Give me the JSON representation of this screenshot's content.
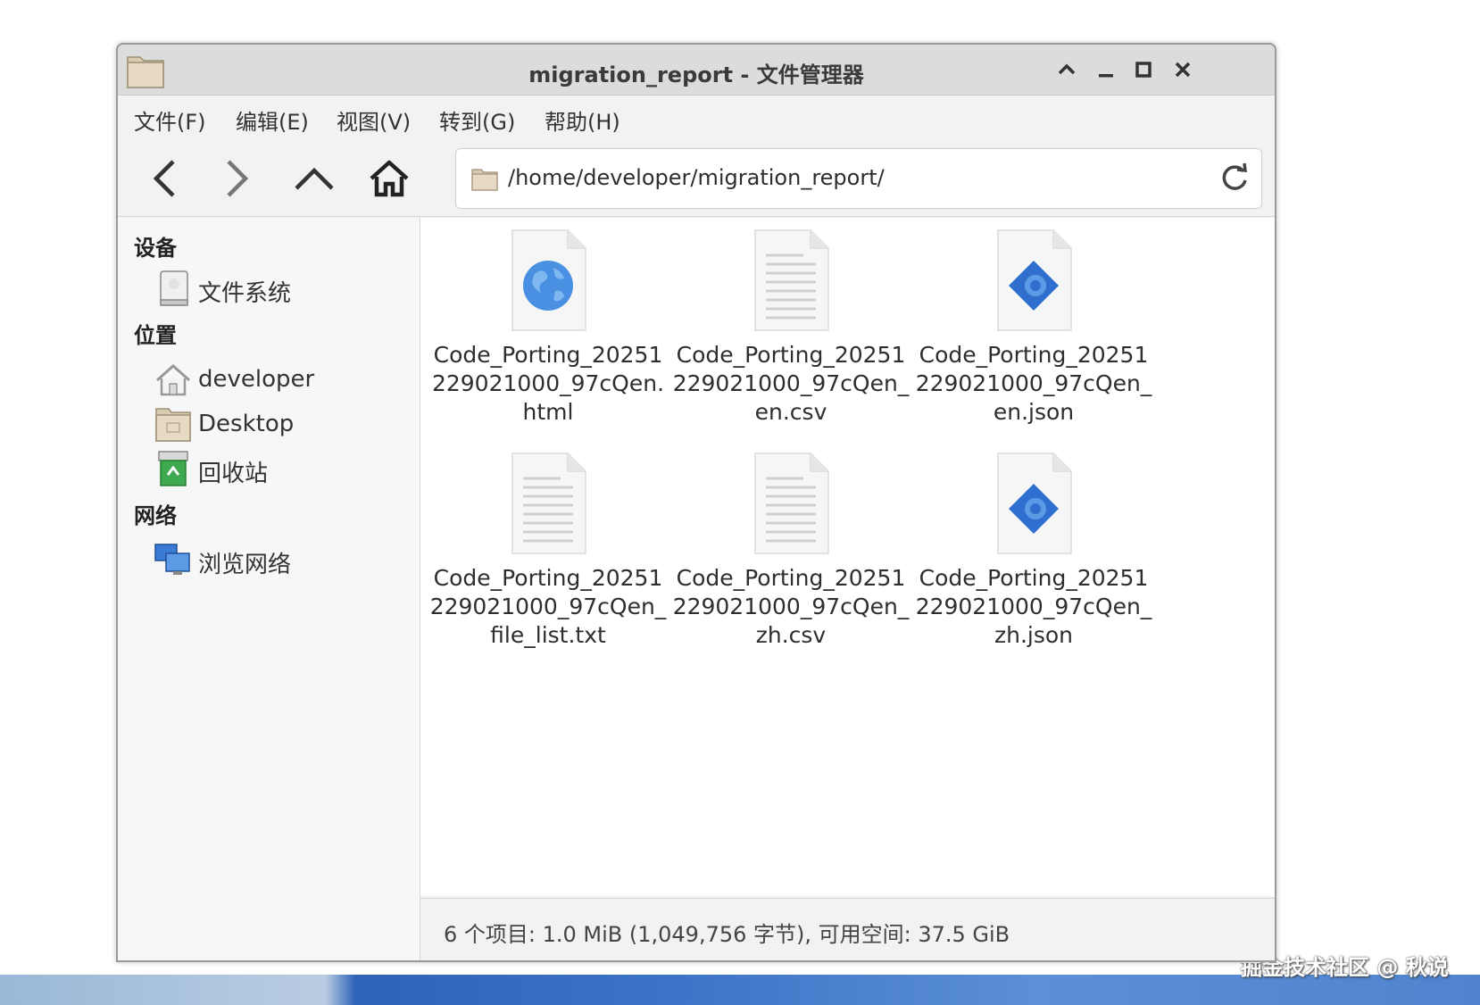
{
  "window": {
    "title": "migration_report - 文件管理器"
  },
  "menu": [
    "文件(F)",
    "编辑(E)",
    "视图(V)",
    "转到(G)",
    "帮助(H)"
  ],
  "toolbar": {
    "path": "/home/developer/migration_report/"
  },
  "sidebar": {
    "devices_header": "设备",
    "places_header": "位置",
    "network_header": "网络",
    "devices": [
      {
        "label": "文件系统",
        "icon": "drive-icon"
      }
    ],
    "places": [
      {
        "label": "developer",
        "icon": "home-folder-icon"
      },
      {
        "label": "Desktop",
        "icon": "desktop-folder-icon"
      },
      {
        "label": "回收站",
        "icon": "trash-icon"
      }
    ],
    "network": [
      {
        "label": "浏览网络",
        "icon": "network-icon"
      }
    ]
  },
  "files": [
    {
      "name": "Code_Porting_20251229021000_97cQen.html",
      "type": "html"
    },
    {
      "name": "Code_Porting_20251229021000_97cQen_en.csv",
      "type": "text"
    },
    {
      "name": "Code_Porting_20251229021000_97cQen_en.json",
      "type": "json"
    },
    {
      "name": "Code_Porting_20251229021000_97cQen_file_list.txt",
      "type": "text"
    },
    {
      "name": "Code_Porting_20251229021000_97cQen_zh.csv",
      "type": "text"
    },
    {
      "name": "Code_Porting_20251229021000_97cQen_zh.json",
      "type": "json"
    }
  ],
  "status": "6 个项目: 1.0 MiB (1,049,756 字节), 可用空间: 37.5 GiB",
  "watermark": "掘金技术社区 @ 秋说",
  "colors": {
    "accent_blue": "#3a7bd5",
    "titlebar": "#dcdcdc"
  }
}
